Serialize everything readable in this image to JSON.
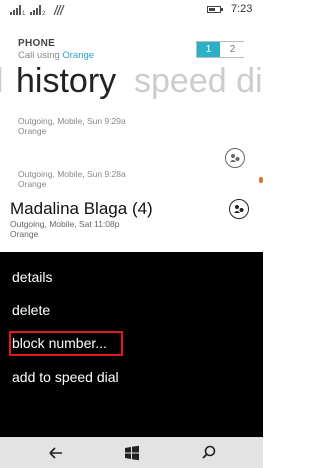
{
  "status_bar": {
    "time": "7:23",
    "signal_1_label": "1",
    "signal_2_label": "2",
    "icons": [
      "signal-icon",
      "signal-icon",
      "wifi-icon",
      "battery-icon"
    ]
  },
  "header": {
    "app_title": "PHONE",
    "subtitle_prefix": "Call using",
    "subtitle_carrier": "Orange",
    "line_selector": [
      "1",
      "2"
    ],
    "selected_line": "1"
  },
  "pivots": {
    "previous": "l",
    "current": "history",
    "next": "speed dia"
  },
  "calls": [
    {
      "meta": "Outgoing, Mobile, Sun 9:29a",
      "carrier": "Orange"
    },
    {
      "meta": "Outgoing, Mobile, Sun 9:28a",
      "carrier": "Orange"
    }
  ],
  "selected_call": {
    "name": "Madalina Blaga",
    "count": "(4)",
    "meta": "Outgoing, Mobile, Sat 11:08p",
    "carrier": "Orange"
  },
  "context_menu": {
    "items": [
      "details",
      "delete",
      "block number...",
      "add to speed dial"
    ],
    "highlighted": "block number..."
  },
  "colors": {
    "accent": "#2bb0c8",
    "menu_bg": "#000000",
    "highlight_border": "#e01a1a",
    "navbar_bg": "#e3e3e3"
  },
  "navbar": {
    "icons": [
      "back-arrow-icon",
      "windows-start-icon",
      "search-icon"
    ]
  }
}
